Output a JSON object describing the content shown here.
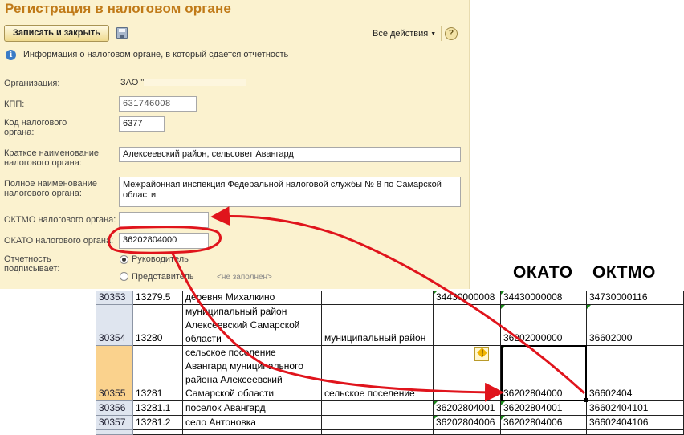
{
  "form": {
    "title": "Регистрация в налоговом органе",
    "save_close_label": "Записать и закрыть",
    "all_actions_label": "Все действия",
    "help_label": "?",
    "info_text": "Информация о налоговом органе, в который сдается отчетность",
    "org_label": "Организация:",
    "org_value": "ЗАО \"",
    "kpp_label": "КПП:",
    "kpp_value": "631746008",
    "tax_code_label_1": "Код налогового",
    "tax_code_label_2": "органа:",
    "tax_code_value": "6377",
    "short_name_label_1": "Краткое наименование",
    "short_name_label_2": "налогового органа:",
    "short_name_value": "Алексеевский район, сельсовет Авангард",
    "full_name_label_1": "Полное наименование",
    "full_name_label_2": "налогового органа:",
    "full_name_value": "Межрайонная инспекция Федеральной налоговой службы № 8 по Самарской области",
    "oktmo_label": "ОКТМО налогового органа:",
    "oktmo_value": "",
    "okato_label": "ОКАТО налогового органа:",
    "okato_value": "36202804000",
    "signer_label_1": "Отчетность",
    "signer_label_2": "подписывает:",
    "signer_options": [
      "Руководитель",
      "Представитель"
    ],
    "signer_selected": "Руководитель",
    "representative_placeholder": "<не заполнен>"
  },
  "headers": {
    "okato": "ОКАТО",
    "oktmo": "ОКТМО"
  },
  "sheet": {
    "rows": [
      {
        "rownum": "30353",
        "code": "13279.5",
        "name": "деревня Михалкино",
        "type": "",
        "c5": "34430000008",
        "okato": "34430000008",
        "oktmo": "34730000116"
      },
      {
        "rownum": "30354",
        "code": "13280",
        "name": "муниципальный район Алексеевский Самарской области",
        "type": "муниципальный район",
        "c5": "",
        "okato": "36202000000",
        "oktmo": "36602000"
      },
      {
        "rownum": "30355",
        "code": "13281",
        "name": "сельское поселение Авангард муниципального района Алексеевский Самарской области",
        "type": "сельское поселение",
        "c5": "",
        "okato": "36202804000",
        "oktmo": "36602404"
      },
      {
        "rownum": "30356",
        "code": "13281.1",
        "name": "поселок Авангард",
        "type": "",
        "c5": "36202804001",
        "okato": "36202804001",
        "oktmo": "36602404101"
      },
      {
        "rownum": "30357",
        "code": "13281.2",
        "name": "село Антоновка",
        "type": "",
        "c5": "36202804006",
        "okato": "36202804006",
        "oktmo": "36602404106"
      }
    ]
  },
  "colors": {
    "form_bg": "#fbf2cf",
    "title": "#c07a18",
    "annotation": "#e0141c",
    "selected_row": "#fad28d"
  }
}
